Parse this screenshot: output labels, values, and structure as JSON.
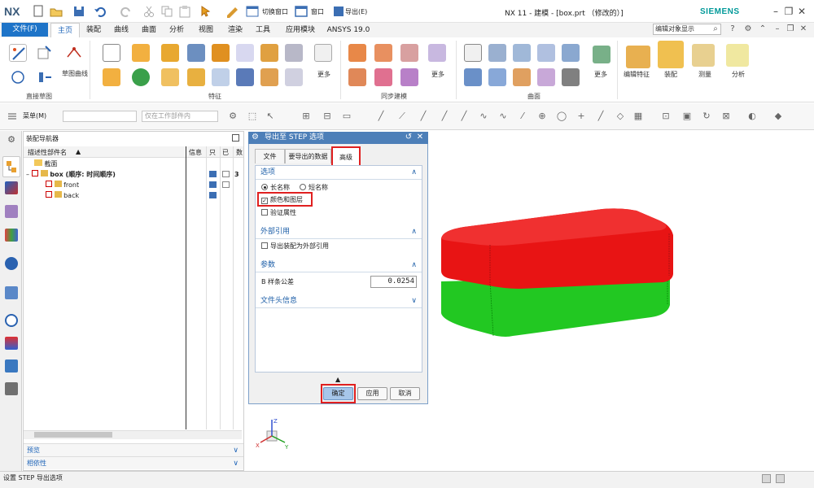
{
  "app": {
    "logo": "NX",
    "title": "NX 11 - 建模 - [box.prt （修改的）]",
    "brand": "SIEMENS",
    "switch_window": "切换窗口",
    "window_menu": "窗口",
    "export_menu": "导出(E)"
  },
  "menubar": {
    "file": "文件(F)",
    "tabs": [
      "主页",
      "装配",
      "曲线",
      "曲面",
      "分析",
      "视图",
      "渲染",
      "工具",
      "应用模块",
      "ANSYS 19.0"
    ],
    "active_tab": "主页",
    "command_search_placeholder": "编辑对象显示"
  },
  "ribbon": {
    "groups": {
      "direct_sketch": "直接草图",
      "feature": "特征",
      "sync_modeling": "同步建模",
      "surface": "曲面"
    },
    "labels": {
      "sketch_curve": "草图曲线",
      "more1": "更多",
      "more2": "更多",
      "more3": "更多",
      "edit_feature": "编辑特征",
      "assembly": "装配",
      "measure": "测量",
      "analysis": "分析"
    }
  },
  "toolbar": {
    "menu": "菜单(M)",
    "filter_placeholder": "仅在工作部件内"
  },
  "navigator": {
    "title": "装配导航器",
    "columns": {
      "name": "描述性部件名",
      "info": "信息",
      "readonly": "只",
      "modified": "已",
      "count": "数"
    },
    "rows": [
      {
        "name": "截面"
      },
      {
        "name": "box (顺序: 时间顺序)",
        "count": "3"
      },
      {
        "name": "front"
      },
      {
        "name": "back"
      }
    ],
    "sections": [
      "预览",
      "相依性"
    ]
  },
  "dialog": {
    "title": "导出至 STEP 选项",
    "tabs": [
      "文件",
      "要导出的数据",
      "高级"
    ],
    "selected_tab": "高级",
    "sections": {
      "options": "选项",
      "external_ref": "外部引用",
      "params": "参数",
      "file_header": "文件头信息"
    },
    "options": {
      "long_name": "长名称",
      "short_name": "短名称",
      "color_layer": "颜色和图层",
      "verify_attr": "验证属性"
    },
    "external": {
      "export_as_ref": "导出装配为外部引用"
    },
    "params": {
      "spline_tol_label": "B 样条公差",
      "spline_tol_value": "0.0254"
    },
    "buttons": {
      "ok": "确定",
      "apply": "应用",
      "cancel": "取消"
    }
  },
  "status": {
    "text": "设置 STEP 导出选项"
  },
  "colors": {
    "accent": "#1e74c8",
    "red_part": "#e81414",
    "green_part": "#22c822",
    "highlight": "#e02020"
  }
}
